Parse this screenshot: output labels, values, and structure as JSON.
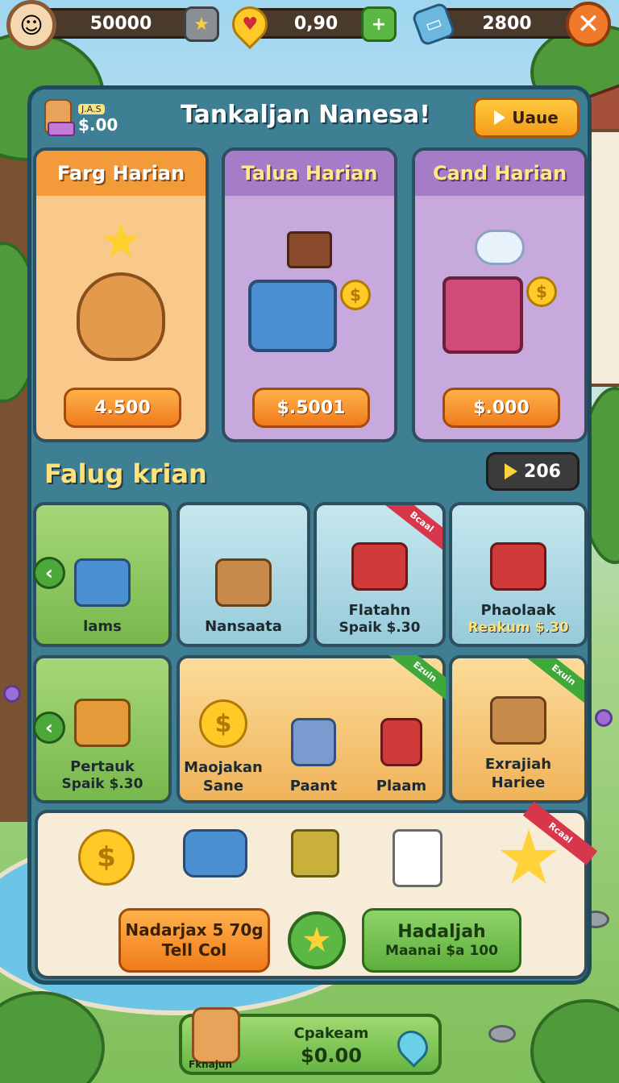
{
  "topbar": {
    "coins": "50000",
    "gems": "0,90",
    "energy": "2800",
    "icons": [
      "avatar-icon",
      "star-hex-icon",
      "heart-gem-icon",
      "plus-icon",
      "ticket-icon",
      "close-icon"
    ]
  },
  "header": {
    "user_mini": "J.A.S",
    "user_amount": "$.00",
    "title": "Tankaljan Nanesa!",
    "action_label": "Uaue"
  },
  "daily_cards": [
    {
      "title": "Farg Harian",
      "price": "4.500"
    },
    {
      "title": "Talua Harian",
      "price": "$.5001"
    },
    {
      "title": "Cand Harian",
      "price": "$.000"
    }
  ],
  "section": {
    "title": "Falug krian",
    "badge_value": "206"
  },
  "row1": [
    {
      "label": "lams",
      "sub": ""
    },
    {
      "label": "Nansaata",
      "sub": ""
    },
    {
      "label": "Flatahn",
      "sub": "Spaik $.30",
      "ribbon": "Bcaal"
    },
    {
      "label": "Phaolaak",
      "sub": "Reakum $.30"
    }
  ],
  "row2": [
    {
      "label": "Pertauk",
      "sub": "Spaik $.30"
    },
    {
      "label": "Maojakan",
      "sub": "Sane"
    },
    {
      "label": "Paant",
      "sub": ""
    },
    {
      "label": "Plaam",
      "sub": "",
      "ribbon": "Ezuin"
    },
    {
      "label": "Exrajiah",
      "sub": "Hariee",
      "ribbon": "Exuin"
    }
  ],
  "shelf": {
    "ribbon": "Rcaal",
    "orange_button": {
      "line1": "Nadarjax 5 70g",
      "line2": "Tell Col"
    },
    "green_button": {
      "line1": "Hadaljah",
      "line2": "Maanai $a 100"
    }
  },
  "footer": {
    "avatar_name": "Fknajun",
    "label": "Cpakeam",
    "value": "$0.00"
  },
  "colors": {
    "panel": "#3f7f94",
    "accent_orange": "#f39a3a",
    "accent_purple": "#a57cc8",
    "accent_green": "#5eae3c",
    "gold": "#ffe27a"
  }
}
